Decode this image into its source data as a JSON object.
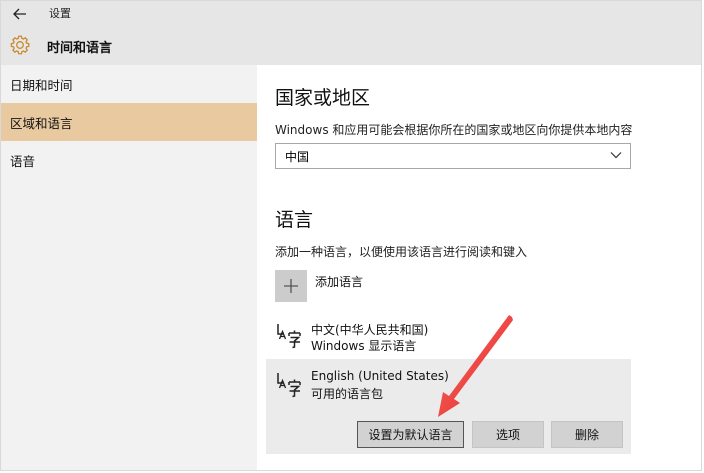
{
  "window": {
    "title": "设置"
  },
  "header": {
    "page_title": "时间和语言"
  },
  "sidebar": {
    "items": [
      {
        "label": "日期和时间"
      },
      {
        "label": "区域和语言"
      },
      {
        "label": "语音"
      }
    ]
  },
  "region": {
    "heading": "国家或地区",
    "description": "Windows 和应用可能会根据你所在的国家或地区向你提供本地内容",
    "selected_value": "中国"
  },
  "language": {
    "heading": "语言",
    "description": "添加一种语言，以便使用该语言进行阅读和键入",
    "add_label": "添加语言",
    "items": [
      {
        "name": "中文(中华人民共和国)",
        "sub": "Windows 显示语言"
      },
      {
        "name": "English (United States)",
        "sub": "可用的语言包"
      }
    ],
    "buttons": {
      "set_default": "设置为默认语言",
      "options": "选项",
      "remove": "删除"
    }
  },
  "colors": {
    "header_bg": "#e6e6e6",
    "sidebar_bg": "#f2f2f2",
    "sidebar_active": "#e8c9a0",
    "gear_accent": "#c98a2e",
    "annotation_arrow": "#e8282b"
  }
}
